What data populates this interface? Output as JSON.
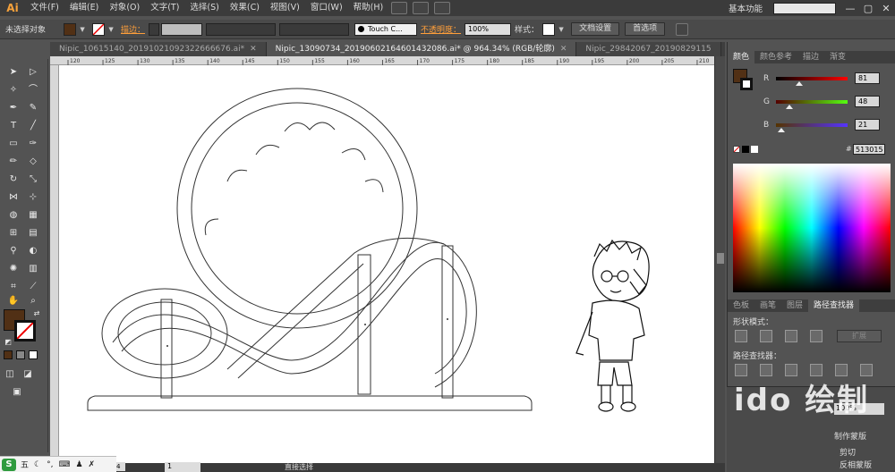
{
  "app": {
    "logo": "Ai",
    "menu": [
      "文件(F)",
      "编辑(E)",
      "对象(O)",
      "文字(T)",
      "选择(S)",
      "效果(C)",
      "视图(V)",
      "窗口(W)",
      "帮助(H)"
    ],
    "workspace": "基本功能",
    "search_placeholder": "",
    "window_controls": [
      "—",
      "▢",
      "✕"
    ]
  },
  "control_bar": {
    "selection_label": "未选择对象",
    "stroke_label": "描边：",
    "brush_name": "Touch C...",
    "opacity_label": "不透明度：",
    "opacity_value": "100%",
    "style_label": "样式：",
    "doc_setup_button": "文档设置",
    "preferences_button": "首选项",
    "fill_color": "#513015"
  },
  "tabs": [
    {
      "label": "Nipic_10615140_20191021092322666676.ai*",
      "active": false
    },
    {
      "label": "Nipic_13090734_20190602164601432086.ai* @ 964.34% (RGB/轮廓)",
      "active": true
    },
    {
      "label": "Nipic_29842067_20190829115",
      "active": false
    }
  ],
  "ruler": {
    "ticks": [
      "120",
      "125",
      "130",
      "135",
      "140",
      "145",
      "150",
      "155",
      "160",
      "165",
      "170",
      "175",
      "180",
      "185",
      "190",
      "195",
      "200",
      "205",
      "210"
    ]
  },
  "color_panel": {
    "tabs": [
      "颜色",
      "颜色参考",
      "描边",
      "渐变"
    ],
    "active_tab": "颜色",
    "channels": [
      {
        "name": "R",
        "value": "81",
        "fraction": 0.32
      },
      {
        "name": "G",
        "value": "48",
        "fraction": 0.19
      },
      {
        "name": "B",
        "value": "21",
        "fraction": 0.08
      }
    ],
    "hex": "513015",
    "hex_prefix": "#",
    "swatch_color": "#513015"
  },
  "pathfinder_panel": {
    "tabs": [
      "色板",
      "画笔",
      "图层",
      "路径查找器"
    ],
    "active_tab": "路径查找器",
    "shape_modes_label": "形状模式：",
    "pathfinders_label": "路径查找器：",
    "expand_button": "扩展"
  },
  "lower_panel": {
    "opacity_value": "100%",
    "make_mask": "制作蒙版",
    "clip": "剪切",
    "invert_mask": "反相蒙版"
  },
  "watermark": "ido 绘制",
  "status": {
    "zoom": "4",
    "page": "1",
    "tool_text": "直接选择"
  },
  "taskbar": {
    "logo": "S",
    "input": "五"
  }
}
